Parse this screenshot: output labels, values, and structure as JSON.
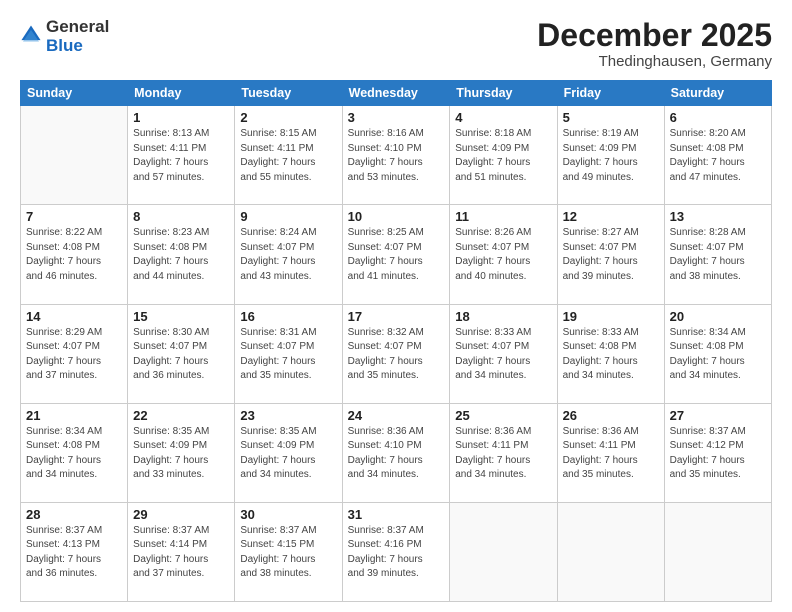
{
  "logo": {
    "general": "General",
    "blue": "Blue"
  },
  "title": "December 2025",
  "location": "Thedinghausen, Germany",
  "days_of_week": [
    "Sunday",
    "Monday",
    "Tuesday",
    "Wednesday",
    "Thursday",
    "Friday",
    "Saturday"
  ],
  "weeks": [
    [
      {
        "day": "",
        "info": ""
      },
      {
        "day": "1",
        "info": "Sunrise: 8:13 AM\nSunset: 4:11 PM\nDaylight: 7 hours\nand 57 minutes."
      },
      {
        "day": "2",
        "info": "Sunrise: 8:15 AM\nSunset: 4:11 PM\nDaylight: 7 hours\nand 55 minutes."
      },
      {
        "day": "3",
        "info": "Sunrise: 8:16 AM\nSunset: 4:10 PM\nDaylight: 7 hours\nand 53 minutes."
      },
      {
        "day": "4",
        "info": "Sunrise: 8:18 AM\nSunset: 4:09 PM\nDaylight: 7 hours\nand 51 minutes."
      },
      {
        "day": "5",
        "info": "Sunrise: 8:19 AM\nSunset: 4:09 PM\nDaylight: 7 hours\nand 49 minutes."
      },
      {
        "day": "6",
        "info": "Sunrise: 8:20 AM\nSunset: 4:08 PM\nDaylight: 7 hours\nand 47 minutes."
      }
    ],
    [
      {
        "day": "7",
        "info": "Sunrise: 8:22 AM\nSunset: 4:08 PM\nDaylight: 7 hours\nand 46 minutes."
      },
      {
        "day": "8",
        "info": "Sunrise: 8:23 AM\nSunset: 4:08 PM\nDaylight: 7 hours\nand 44 minutes."
      },
      {
        "day": "9",
        "info": "Sunrise: 8:24 AM\nSunset: 4:07 PM\nDaylight: 7 hours\nand 43 minutes."
      },
      {
        "day": "10",
        "info": "Sunrise: 8:25 AM\nSunset: 4:07 PM\nDaylight: 7 hours\nand 41 minutes."
      },
      {
        "day": "11",
        "info": "Sunrise: 8:26 AM\nSunset: 4:07 PM\nDaylight: 7 hours\nand 40 minutes."
      },
      {
        "day": "12",
        "info": "Sunrise: 8:27 AM\nSunset: 4:07 PM\nDaylight: 7 hours\nand 39 minutes."
      },
      {
        "day": "13",
        "info": "Sunrise: 8:28 AM\nSunset: 4:07 PM\nDaylight: 7 hours\nand 38 minutes."
      }
    ],
    [
      {
        "day": "14",
        "info": "Sunrise: 8:29 AM\nSunset: 4:07 PM\nDaylight: 7 hours\nand 37 minutes."
      },
      {
        "day": "15",
        "info": "Sunrise: 8:30 AM\nSunset: 4:07 PM\nDaylight: 7 hours\nand 36 minutes."
      },
      {
        "day": "16",
        "info": "Sunrise: 8:31 AM\nSunset: 4:07 PM\nDaylight: 7 hours\nand 35 minutes."
      },
      {
        "day": "17",
        "info": "Sunrise: 8:32 AM\nSunset: 4:07 PM\nDaylight: 7 hours\nand 35 minutes."
      },
      {
        "day": "18",
        "info": "Sunrise: 8:33 AM\nSunset: 4:07 PM\nDaylight: 7 hours\nand 34 minutes."
      },
      {
        "day": "19",
        "info": "Sunrise: 8:33 AM\nSunset: 4:08 PM\nDaylight: 7 hours\nand 34 minutes."
      },
      {
        "day": "20",
        "info": "Sunrise: 8:34 AM\nSunset: 4:08 PM\nDaylight: 7 hours\nand 34 minutes."
      }
    ],
    [
      {
        "day": "21",
        "info": "Sunrise: 8:34 AM\nSunset: 4:08 PM\nDaylight: 7 hours\nand 34 minutes."
      },
      {
        "day": "22",
        "info": "Sunrise: 8:35 AM\nSunset: 4:09 PM\nDaylight: 7 hours\nand 33 minutes."
      },
      {
        "day": "23",
        "info": "Sunrise: 8:35 AM\nSunset: 4:09 PM\nDaylight: 7 hours\nand 34 minutes."
      },
      {
        "day": "24",
        "info": "Sunrise: 8:36 AM\nSunset: 4:10 PM\nDaylight: 7 hours\nand 34 minutes."
      },
      {
        "day": "25",
        "info": "Sunrise: 8:36 AM\nSunset: 4:11 PM\nDaylight: 7 hours\nand 34 minutes."
      },
      {
        "day": "26",
        "info": "Sunrise: 8:36 AM\nSunset: 4:11 PM\nDaylight: 7 hours\nand 35 minutes."
      },
      {
        "day": "27",
        "info": "Sunrise: 8:37 AM\nSunset: 4:12 PM\nDaylight: 7 hours\nand 35 minutes."
      }
    ],
    [
      {
        "day": "28",
        "info": "Sunrise: 8:37 AM\nSunset: 4:13 PM\nDaylight: 7 hours\nand 36 minutes."
      },
      {
        "day": "29",
        "info": "Sunrise: 8:37 AM\nSunset: 4:14 PM\nDaylight: 7 hours\nand 37 minutes."
      },
      {
        "day": "30",
        "info": "Sunrise: 8:37 AM\nSunset: 4:15 PM\nDaylight: 7 hours\nand 38 minutes."
      },
      {
        "day": "31",
        "info": "Sunrise: 8:37 AM\nSunset: 4:16 PM\nDaylight: 7 hours\nand 39 minutes."
      },
      {
        "day": "",
        "info": ""
      },
      {
        "day": "",
        "info": ""
      },
      {
        "day": "",
        "info": ""
      }
    ]
  ]
}
